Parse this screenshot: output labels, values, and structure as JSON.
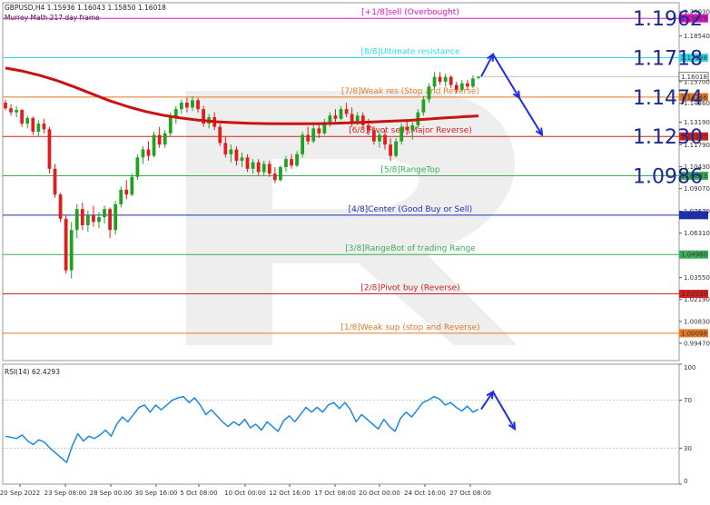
{
  "header": {
    "symbol_line": "GBPUSD,H4  1.15936 1.16043 1.15850 1.16018",
    "indicator_line": "Murrey Math 217 day frame"
  },
  "chart_data": {
    "type": "candlestick",
    "symbol": "GBPUSD",
    "timeframe": "H4",
    "ohlc": {
      "open": 1.15936,
      "high": 1.16043,
      "low": 1.1585,
      "close": 1.16018
    },
    "current_price_label": "1.16018",
    "price_axis": {
      "ylim": [
        0.984,
        1.206
      ],
      "ticks": [
        "1.20030",
        "1.18540",
        "1.15700",
        "1.14360",
        "1.13190",
        "1.11790",
        "1.10430",
        "1.09070",
        "1.07670",
        "1.06310",
        "1.03550",
        "1.02190",
        "1.00830",
        "0.99470"
      ]
    },
    "time_axis": {
      "labels": [
        "20 Sep 2022",
        "23 Sep 08:00",
        "28 Sep 00:00",
        "30 Sep 16:00",
        "5 Oct 08:00",
        "10 Oct 00:00",
        "12 Oct 16:00",
        "17 Oct 08:00",
        "20 Oct 00:00",
        "24 Oct 16:00",
        "27 Oct 08:00"
      ]
    },
    "murrey_levels": [
      {
        "text": "[+1/8]sell (Overbought)",
        "price": 1.19629,
        "tag": "1.19629",
        "color": "#e010c8"
      },
      {
        "text": "[8/8]Ultimate resistance",
        "price": 1.17188,
        "tag": "1.17188",
        "color": "#2fd6e6"
      },
      {
        "text": "[7/8]Weak res (Stop and Reverse)",
        "price": 1.14746,
        "tag": "1.14746",
        "color": "#e87722"
      },
      {
        "text": "[6/8]Pivot sell (Major Reverse)",
        "price": 1.12305,
        "tag": "1.12305",
        "color": "#d42020"
      },
      {
        "text": "[5/8]RangeTop",
        "price": 1.09863,
        "tag": "1.09863",
        "color": "#3cae5a"
      },
      {
        "text": "[4/8]Center (Good Buy or Sell)",
        "price": 1.07422,
        "tag": "1.07422",
        "color": "#1b2fb8"
      },
      {
        "text": "[3/8]RangeBot of trading Range",
        "price": 1.0498,
        "tag": "1.04980",
        "color": "#3cae5a"
      },
      {
        "text": "[2/8]Pivot buy (Reverse)",
        "price": 1.02539,
        "tag": "1.02539",
        "color": "#d42020"
      },
      {
        "text": "[1/8]Weak sup (stop and Reverse)",
        "price": 1.00098,
        "tag": "1.00098",
        "color": "#e87722"
      }
    ],
    "big_labels": [
      {
        "text": "1.1962",
        "price": 1.19629
      },
      {
        "text": "1.1718",
        "price": 1.17188
      },
      {
        "text": "1.1474",
        "price": 1.14746
      },
      {
        "text": "1.1230",
        "price": 1.12305
      },
      {
        "text": "1.0986",
        "price": 1.09863
      }
    ],
    "candles": [
      [
        1.144,
        1.1458,
        1.1392,
        1.1405
      ],
      [
        1.1405,
        1.143,
        1.136,
        1.138
      ],
      [
        1.138,
        1.142,
        1.135,
        1.1395
      ],
      [
        1.1395,
        1.14,
        1.129,
        1.131
      ],
      [
        1.131,
        1.136,
        1.128,
        1.1345
      ],
      [
        1.1345,
        1.1355,
        1.124,
        1.126
      ],
      [
        1.126,
        1.133,
        1.123,
        1.131
      ],
      [
        1.131,
        1.134,
        1.125,
        1.1275
      ],
      [
        1.1275,
        1.129,
        1.1,
        1.103
      ],
      [
        1.103,
        1.106,
        1.085,
        1.087
      ],
      [
        1.087,
        1.088,
        1.07,
        1.072
      ],
      [
        1.072,
        1.074,
        1.038,
        1.04
      ],
      [
        1.04,
        1.07,
        1.035,
        1.065
      ],
      [
        1.065,
        1.081,
        1.06,
        1.078
      ],
      [
        1.078,
        1.082,
        1.065,
        1.068
      ],
      [
        1.068,
        1.077,
        1.064,
        1.074
      ],
      [
        1.074,
        1.08,
        1.067,
        1.07
      ],
      [
        1.07,
        1.076,
        1.066,
        1.073
      ],
      [
        1.073,
        1.08,
        1.069,
        1.078
      ],
      [
        1.078,
        1.079,
        1.06,
        1.065
      ],
      [
        1.065,
        1.083,
        1.062,
        1.081
      ],
      [
        1.081,
        1.092,
        1.079,
        1.09
      ],
      [
        1.09,
        1.096,
        1.084,
        1.087
      ],
      [
        1.087,
        1.1,
        1.086,
        1.098
      ],
      [
        1.098,
        1.112,
        1.096,
        1.11
      ],
      [
        1.11,
        1.117,
        1.106,
        1.115
      ],
      [
        1.115,
        1.12,
        1.108,
        1.111
      ],
      [
        1.111,
        1.126,
        1.11,
        1.124
      ],
      [
        1.124,
        1.129,
        1.116,
        1.118
      ],
      [
        1.118,
        1.127,
        1.116,
        1.125
      ],
      [
        1.125,
        1.138,
        1.123,
        1.135
      ],
      [
        1.135,
        1.142,
        1.131,
        1.14
      ],
      [
        1.14,
        1.146,
        1.137,
        1.144
      ],
      [
        1.144,
        1.147,
        1.138,
        1.141
      ],
      [
        1.141,
        1.148,
        1.139,
        1.1455
      ],
      [
        1.1455,
        1.147,
        1.138,
        1.14
      ],
      [
        1.14,
        1.142,
        1.129,
        1.131
      ],
      [
        1.131,
        1.137,
        1.128,
        1.135
      ],
      [
        1.135,
        1.138,
        1.127,
        1.129
      ],
      [
        1.129,
        1.131,
        1.117,
        1.119
      ],
      [
        1.119,
        1.123,
        1.11,
        1.112
      ],
      [
        1.112,
        1.118,
        1.107,
        1.115
      ],
      [
        1.115,
        1.117,
        1.105,
        1.108
      ],
      [
        1.108,
        1.113,
        1.104,
        1.11
      ],
      [
        1.11,
        1.112,
        1.101,
        1.103
      ],
      [
        1.103,
        1.109,
        1.1,
        1.107
      ],
      [
        1.107,
        1.109,
        1.099,
        1.101
      ],
      [
        1.101,
        1.108,
        1.099,
        1.106
      ],
      [
        1.106,
        1.108,
        1.098,
        1.1
      ],
      [
        1.1,
        1.104,
        1.094,
        1.096
      ],
      [
        1.096,
        1.105,
        1.095,
        1.104
      ],
      [
        1.104,
        1.111,
        1.101,
        1.109
      ],
      [
        1.109,
        1.112,
        1.103,
        1.105
      ],
      [
        1.105,
        1.114,
        1.104,
        1.112
      ],
      [
        1.112,
        1.126,
        1.11,
        1.124
      ],
      [
        1.124,
        1.129,
        1.118,
        1.12
      ],
      [
        1.12,
        1.13,
        1.119,
        1.128
      ],
      [
        1.128,
        1.131,
        1.122,
        1.125
      ],
      [
        1.125,
        1.134,
        1.124,
        1.132
      ],
      [
        1.132,
        1.138,
        1.129,
        1.136
      ],
      [
        1.136,
        1.14,
        1.132,
        1.134
      ],
      [
        1.134,
        1.142,
        1.133,
        1.14
      ],
      [
        1.14,
        1.144,
        1.135,
        1.137
      ],
      [
        1.137,
        1.141,
        1.129,
        1.131
      ],
      [
        1.131,
        1.138,
        1.13,
        1.136
      ],
      [
        1.136,
        1.138,
        1.128,
        1.13
      ],
      [
        1.13,
        1.134,
        1.124,
        1.127
      ],
      [
        1.127,
        1.129,
        1.118,
        1.12
      ],
      [
        1.12,
        1.126,
        1.116,
        1.124
      ],
      [
        1.124,
        1.127,
        1.115,
        1.118
      ],
      [
        1.118,
        1.122,
        1.108,
        1.111
      ],
      [
        1.111,
        1.122,
        1.11,
        1.12
      ],
      [
        1.12,
        1.131,
        1.118,
        1.129
      ],
      [
        1.129,
        1.134,
        1.124,
        1.127
      ],
      [
        1.127,
        1.132,
        1.121,
        1.13
      ],
      [
        1.13,
        1.14,
        1.128,
        1.138
      ],
      [
        1.138,
        1.148,
        1.136,
        1.146
      ],
      [
        1.146,
        1.156,
        1.144,
        1.154
      ],
      [
        1.154,
        1.163,
        1.152,
        1.16
      ],
      [
        1.16,
        1.163,
        1.155,
        1.157
      ],
      [
        1.157,
        1.162,
        1.154,
        1.16
      ],
      [
        1.16,
        1.161,
        1.153,
        1.155
      ],
      [
        1.155,
        1.157,
        1.15,
        1.152
      ],
      [
        1.152,
        1.158,
        1.151,
        1.156
      ],
      [
        1.156,
        1.158,
        1.152,
        1.154
      ],
      [
        1.154,
        1.161,
        1.153,
        1.159
      ],
      [
        1.15936,
        1.16043,
        1.1585,
        1.16018
      ]
    ],
    "moving_average": [
      1.1655,
      1.1635,
      1.1608,
      1.1575,
      1.1535,
      1.1492,
      1.145,
      1.1415,
      1.1385,
      1.1362,
      1.1345,
      1.1332,
      1.1322,
      1.1316,
      1.1312,
      1.131,
      1.1309,
      1.1309,
      1.131,
      1.1313,
      1.1316,
      1.132,
      1.1325,
      1.133,
      1.1337,
      1.1345,
      1.1352,
      1.1358
    ],
    "forecast_price": [
      [
        1.16018,
        1.174
      ],
      [
        1.174,
        1.147
      ],
      [
        1.147,
        1.124
      ]
    ],
    "rsi": {
      "label": "RSI(14) 62.4293",
      "period": 14,
      "last": 62.4293,
      "ylim": [
        0,
        100
      ],
      "ticks": [
        100,
        70,
        30,
        0
      ],
      "values": [
        40,
        39,
        38,
        41,
        36,
        33,
        37,
        35,
        30,
        26,
        22,
        18,
        32,
        42,
        36,
        40,
        38,
        41,
        45,
        40,
        50,
        56,
        52,
        58,
        64,
        66,
        60,
        66,
        62,
        66,
        70,
        72,
        73,
        68,
        72,
        66,
        58,
        62,
        57,
        52,
        48,
        52,
        49,
        54,
        47,
        50,
        45,
        52,
        48,
        44,
        53,
        57,
        52,
        58,
        64,
        60,
        64,
        60,
        66,
        68,
        63,
        68,
        62,
        52,
        58,
        54,
        50,
        46,
        54,
        48,
        44,
        55,
        60,
        56,
        62,
        68,
        70,
        73,
        71,
        66,
        68,
        64,
        61,
        65,
        60,
        62.4293
      ],
      "forecast": [
        [
          62.4293,
          77
        ],
        [
          77,
          46
        ]
      ]
    }
  }
}
